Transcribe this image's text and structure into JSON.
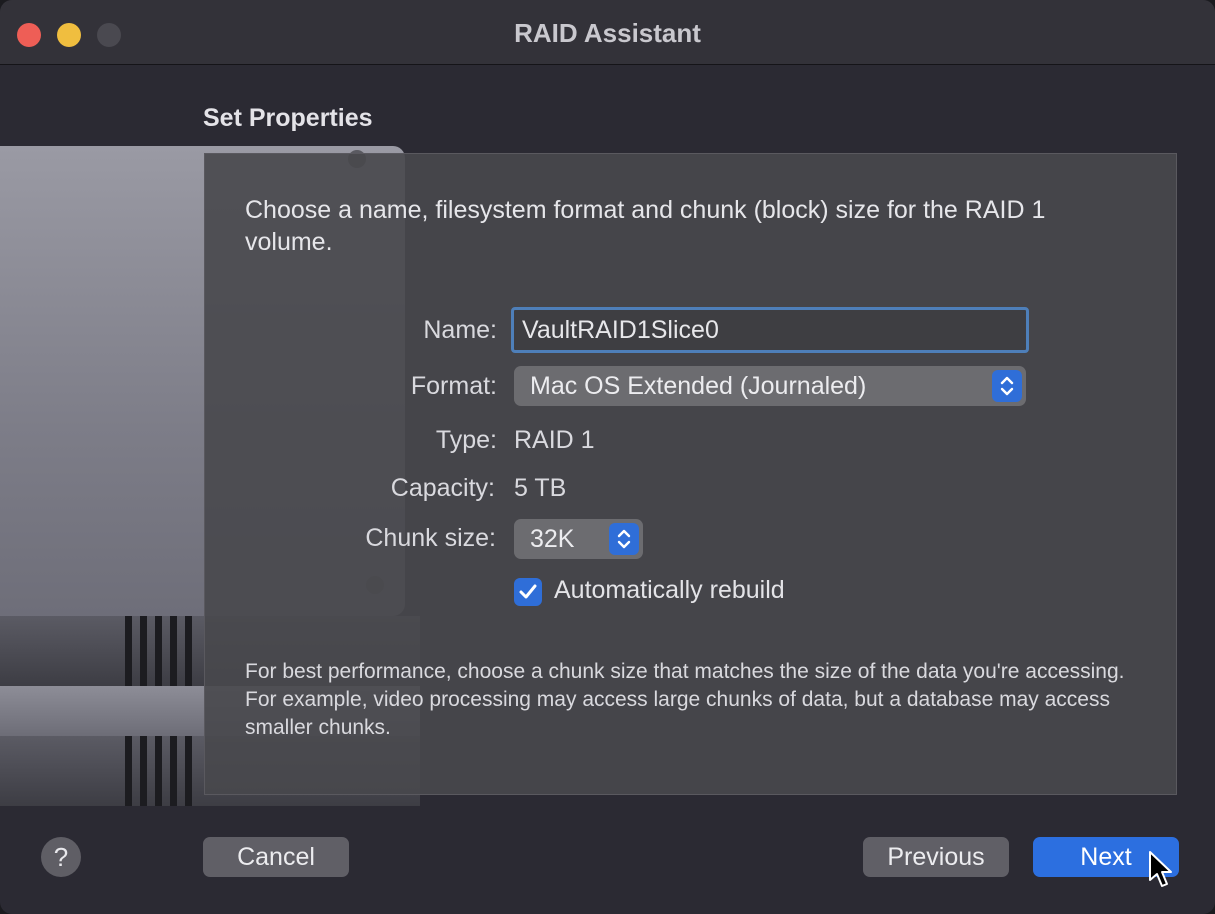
{
  "window": {
    "title": "RAID Assistant"
  },
  "page": {
    "section_title": "Set Properties",
    "intro": "Choose a name, filesystem format and chunk (block) size for the RAID 1 volume.",
    "note": "For best performance, choose a chunk size that matches the size of the data you're accessing. For example, video processing may access large chunks of data, but a database may access smaller chunks."
  },
  "form": {
    "name_label": "Name:",
    "name_value": "VaultRAID1Slice0",
    "format_label": "Format:",
    "format_value": "Mac OS Extended (Journaled)",
    "type_label": "Type:",
    "type_value": "RAID 1",
    "capacity_label": "Capacity:",
    "capacity_value": "5 TB",
    "chunk_label": "Chunk size:",
    "chunk_value": "32K",
    "rebuild_label": "Automatically rebuild",
    "rebuild_checked": true
  },
  "buttons": {
    "help": "?",
    "cancel": "Cancel",
    "previous": "Previous",
    "next": "Next"
  },
  "colors": {
    "accent": "#2c6fe0",
    "focus_ring": "#4e7fb9",
    "close": "#ee5e56",
    "minimize": "#f0be3f"
  }
}
